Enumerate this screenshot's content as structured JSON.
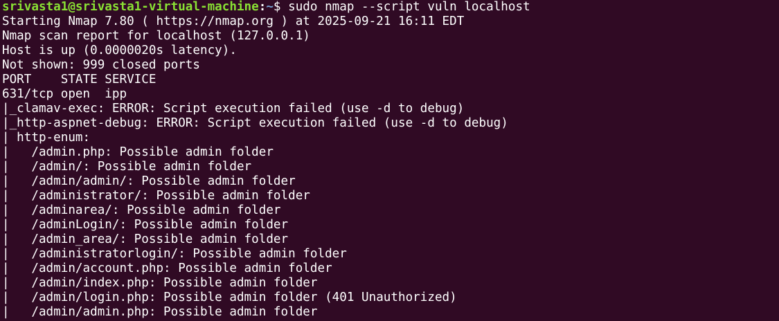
{
  "prompt": {
    "user_host": "srivasta1@srivasta1-virtual-machine",
    "separator": ":",
    "path": "~",
    "symbol": "$ ",
    "command": "sudo nmap --script vuln localhost"
  },
  "output": [
    "Starting Nmap 7.80 ( https://nmap.org ) at 2025-09-21 16:11 EDT",
    "Nmap scan report for localhost (127.0.0.1)",
    "Host is up (0.0000020s latency).",
    "Not shown: 999 closed ports",
    "PORT    STATE SERVICE",
    "631/tcp open  ipp",
    "|_clamav-exec: ERROR: Script execution failed (use -d to debug)",
    "|_http-aspnet-debug: ERROR: Script execution failed (use -d to debug)",
    "| http-enum:",
    "|   /admin.php: Possible admin folder",
    "|   /admin/: Possible admin folder",
    "|   /admin/admin/: Possible admin folder",
    "|   /administrator/: Possible admin folder",
    "|   /adminarea/: Possible admin folder",
    "|   /adminLogin/: Possible admin folder",
    "|   /admin_area/: Possible admin folder",
    "|   /administratorlogin/: Possible admin folder",
    "|   /admin/account.php: Possible admin folder",
    "|   /admin/index.php: Possible admin folder",
    "|   /admin/login.php: Possible admin folder (401 Unauthorized)",
    "|   /admin/admin.php: Possible admin folder"
  ],
  "colors": {
    "background": "#300a24",
    "prompt_user": "#8ae234",
    "prompt_path": "#729fcf",
    "text": "#ffffff"
  }
}
